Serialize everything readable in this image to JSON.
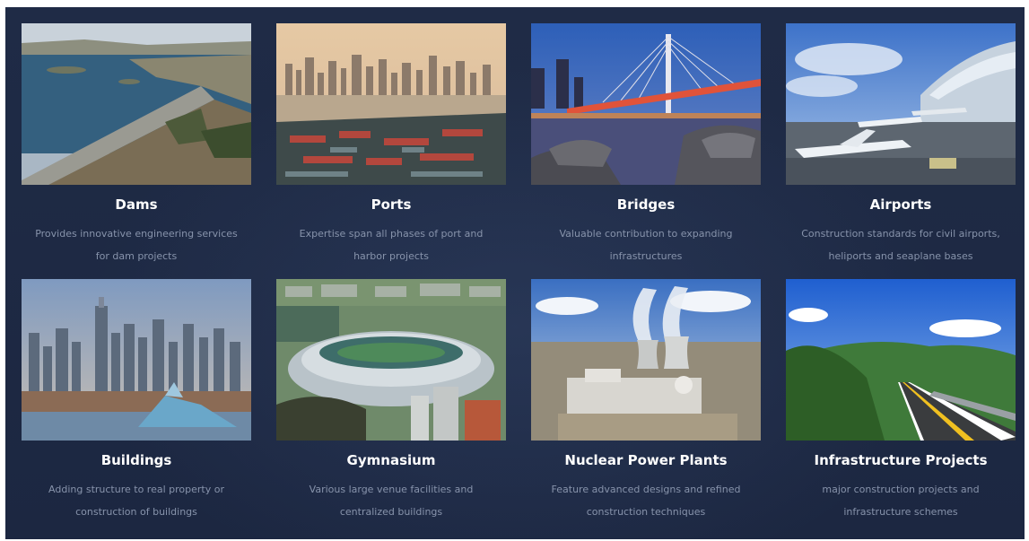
{
  "cards": [
    {
      "title": "Dams",
      "line1": "Provides innovative engineering services",
      "line2": "for dam projects"
    },
    {
      "title": "Ports",
      "line1": "Expertise span all phases of port and",
      "line2": "harbor projects"
    },
    {
      "title": "Bridges",
      "line1": "Valuable contribution to expanding",
      "line2": "infrastructures"
    },
    {
      "title": "Airports",
      "line1": "Construction standards for civil airports,",
      "line2": "heliports and seaplane bases"
    },
    {
      "title": "Buildings",
      "line1": "Adding structure to real property or",
      "line2": "construction of buildings"
    },
    {
      "title": "Gymnasium",
      "line1": "Various large venue facilities and",
      "line2": "centralized buildings"
    },
    {
      "title": "Nuclear Power Plants",
      "line1": "Feature advanced designs and refined",
      "line2": "construction techniques"
    },
    {
      "title": "Infrastructure Projects",
      "line1": "major construction projects and",
      "line2": "infrastructure schemes"
    }
  ],
  "colors": {
    "panel": "#1e2a44",
    "title": "#ffffff",
    "description": "#8793ab"
  }
}
